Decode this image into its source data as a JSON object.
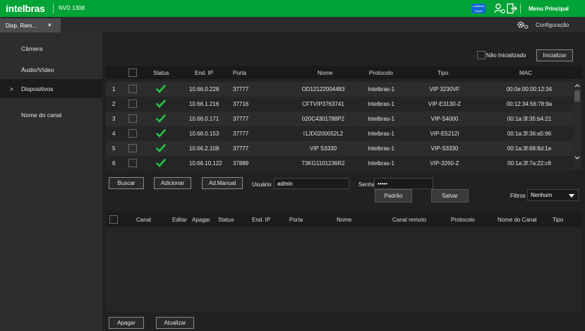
{
  "header": {
    "brand": "intelbras",
    "model": "NVD 1308",
    "cloud_badge": "Intelbras Cloud",
    "main_menu": "Menu Principal"
  },
  "tabs": [
    {
      "label": "Disp. Rem...",
      "close": "×"
    }
  ],
  "config_label": "Configuração",
  "sidebar": {
    "items": [
      {
        "label": "Câmera",
        "active": false,
        "arrow": ""
      },
      {
        "label": "Áudio/Vídeo",
        "active": false,
        "arrow": ""
      },
      {
        "label": "Dispositivos",
        "active": true,
        "arrow": ">"
      },
      {
        "label": "Nome do canal",
        "active": false,
        "arrow": ""
      }
    ]
  },
  "search": {
    "not_initialized_label": "Não Inicializado",
    "initialize_button": "Inicializar",
    "columns": [
      "Status",
      "End. IP",
      "Porta",
      "Nome",
      "Protocolo",
      "Tipo",
      "MAC"
    ],
    "rows": [
      {
        "num": "1",
        "ip": "10.66.0.228",
        "port": "37777",
        "name": "OD12122004483",
        "protocol": "Intelbras-1",
        "type": "VIP 3230VF",
        "mac": "00:0e:00:00:12:34"
      },
      {
        "num": "2",
        "ip": "10.66.1.216",
        "port": "37716",
        "name": "CFTVIP3763741",
        "protocol": "Intelbras-1",
        "type": "VIP-E3130-Z",
        "mac": "00:12:34:56:78:9a"
      },
      {
        "num": "3",
        "ip": "10.66.0.171",
        "port": "37777",
        "name": "020C4301788P2",
        "protocol": "Intelbras-1",
        "type": "VIP-S4000",
        "mac": "00:1a:3f:35:b4:21"
      },
      {
        "num": "4",
        "ip": "10.66.0.153",
        "port": "37777",
        "name": "I1JD0200052L2",
        "protocol": "Intelbras-1",
        "type": "VIP-E5212I",
        "mac": "00:1a:3f:36:a5:96"
      },
      {
        "num": "5",
        "ip": "10.66.2.108",
        "port": "37777",
        "name": "VIP S3330",
        "protocol": "Intelbras-1",
        "type": "VIP-S3330",
        "mac": "00:1a:3f:68:8d:1e"
      },
      {
        "num": "6",
        "ip": "10.66.10.122",
        "port": "37889",
        "name": "73KG1101236R2",
        "protocol": "Intelbras-1",
        "type": "VIP-3260-Z",
        "mac": "00:1a:3f:7a:22:c8"
      }
    ]
  },
  "actions": {
    "search": "Buscar",
    "add": "Adicionar",
    "manual_add": "Ad.Manual",
    "user_label": "Usuário",
    "user_value": "admin",
    "password_label": "Senha",
    "password_value": "•••••",
    "default_button": "Padrão",
    "save_button": "Salvar",
    "filter_label": "Filtros",
    "filter_value": "Nenhum"
  },
  "channels": {
    "columns": [
      "Canal",
      "Editar",
      "Apagar",
      "Status",
      "End. IP",
      "Porta",
      "Nome",
      "Canal remoto",
      "Protocolo",
      "Nome do Canal",
      "Tipo"
    ]
  },
  "footer": {
    "delete_button": "Apagar",
    "refresh_button": "Atualizar"
  },
  "colors": {
    "brand_green": "#00a335",
    "status_ok": "#20c64a"
  }
}
